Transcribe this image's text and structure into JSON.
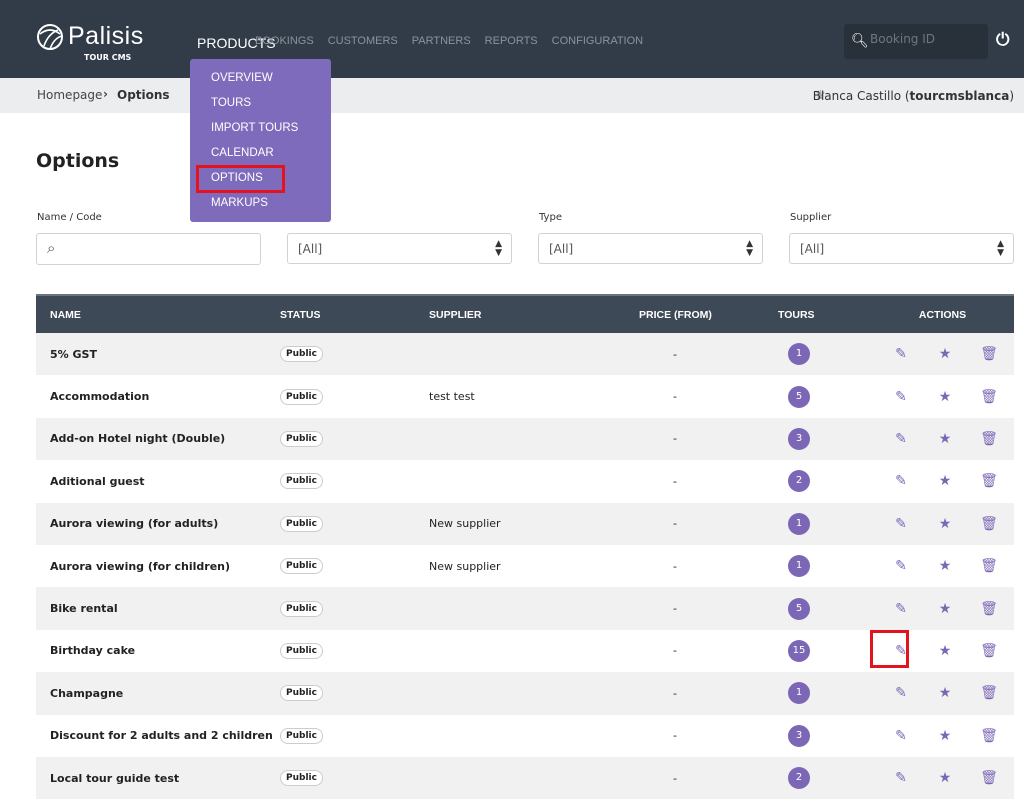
{
  "brand": {
    "name": "Palisis",
    "sub": "TOUR CMS"
  },
  "nav": [
    "PRODUCTS",
    "BOOKINGS",
    "CUSTOMERS",
    "PARTNERS",
    "REPORTS",
    "CONFIGURATION"
  ],
  "search": {
    "placeholder": "Booking ID"
  },
  "products_menu": [
    "OVERVIEW",
    "TOURS",
    "IMPORT TOURS",
    "CALENDAR",
    "OPTIONS",
    "MARKUPS"
  ],
  "breadcrumb": {
    "home": "Homepage",
    "current": "Options"
  },
  "user": {
    "name": "Blanca Castillo (",
    "login": "tourcmsblanca",
    ")": ")",
    "close": ")"
  },
  "page_title": "Options",
  "filters": {
    "name_label": "Name / Code",
    "type_label": "Type",
    "supplier_label": "Supplier",
    "all": "[All]"
  },
  "table": {
    "headers": [
      "NAME",
      "STATUS",
      "SUPPLIER",
      "PRICE (FROM)",
      "TOURS",
      "ACTIONS"
    ],
    "rows": [
      {
        "name": "5% GST",
        "status": "Public",
        "supplier": "",
        "price": "-",
        "tours": "1"
      },
      {
        "name": "Accommodation",
        "status": "Public",
        "supplier": "test test",
        "price": "-",
        "tours": "5"
      },
      {
        "name": "Add-on Hotel night (Double)",
        "status": "Public",
        "supplier": "",
        "price": "-",
        "tours": "3"
      },
      {
        "name": "Aditional guest",
        "status": "Public",
        "supplier": "",
        "price": "-",
        "tours": "2"
      },
      {
        "name": "Aurora viewing (for adults)",
        "status": "Public",
        "supplier": "New supplier",
        "price": "-",
        "tours": "1"
      },
      {
        "name": "Aurora viewing (for children)",
        "status": "Public",
        "supplier": "New supplier",
        "price": "-",
        "tours": "1"
      },
      {
        "name": "Bike rental",
        "status": "Public",
        "supplier": "",
        "price": "-",
        "tours": "5"
      },
      {
        "name": "Birthday cake",
        "status": "Public",
        "supplier": "",
        "price": "-",
        "tours": "15"
      },
      {
        "name": "Champagne",
        "status": "Public",
        "supplier": "",
        "price": "-",
        "tours": "1"
      },
      {
        "name": "Discount for 2 adults and 2 children",
        "status": "Public",
        "supplier": "",
        "price": "-",
        "tours": "3"
      },
      {
        "name": "Local tour guide test",
        "status": "Public",
        "supplier": "",
        "price": "-",
        "tours": "2"
      }
    ]
  }
}
